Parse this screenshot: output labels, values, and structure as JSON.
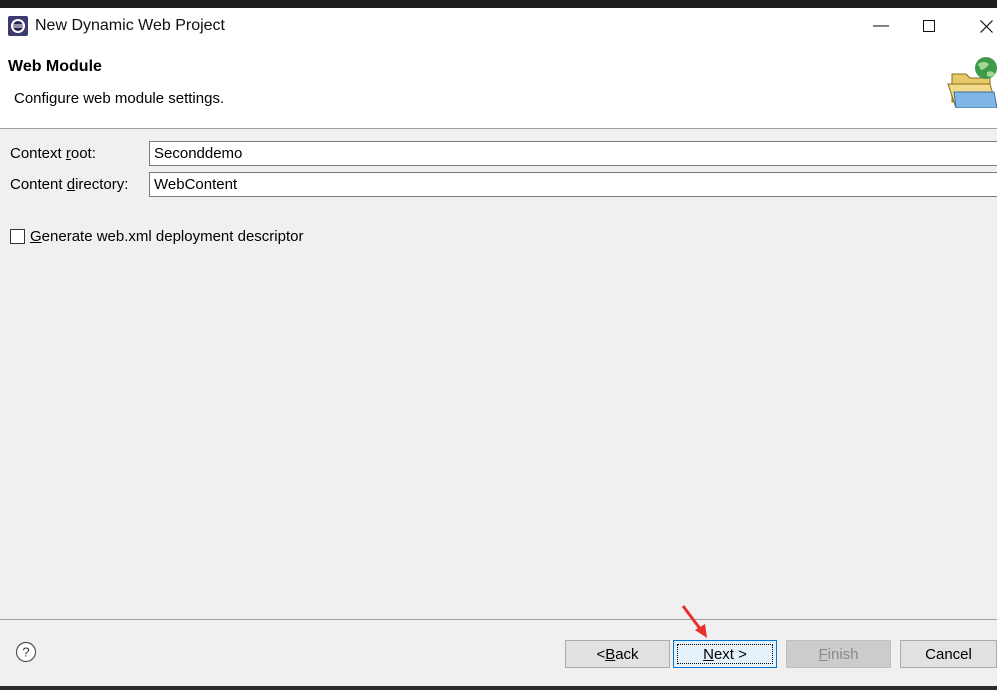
{
  "window": {
    "title": "New Dynamic Web Project",
    "controls": [
      "minimize",
      "maximize",
      "close"
    ]
  },
  "header": {
    "title": "Web Module",
    "description": "Configure web module settings."
  },
  "form": {
    "context_root": {
      "label_pre": "Context ",
      "label_mnemonic": "r",
      "label_post": "oot:",
      "value": "Seconddemo"
    },
    "content_directory": {
      "label_pre": "Content ",
      "label_mnemonic": "d",
      "label_post": "irectory:",
      "value": "WebContent"
    },
    "generate_descriptor": {
      "label_mnemonic": "G",
      "label_post": "enerate web.xml deployment descriptor",
      "checked": false
    }
  },
  "buttons": {
    "back": {
      "pre": "< ",
      "mnemonic": "B",
      "post": "ack"
    },
    "next": {
      "mnemonic": "N",
      "post": "ext >"
    },
    "finish": {
      "mnemonic": "F",
      "post": "inish",
      "enabled": false
    },
    "cancel": {
      "label": "Cancel"
    }
  },
  "colors": {
    "annotation_arrow": "#e8302a",
    "primary_button_border": "#0078d7"
  }
}
